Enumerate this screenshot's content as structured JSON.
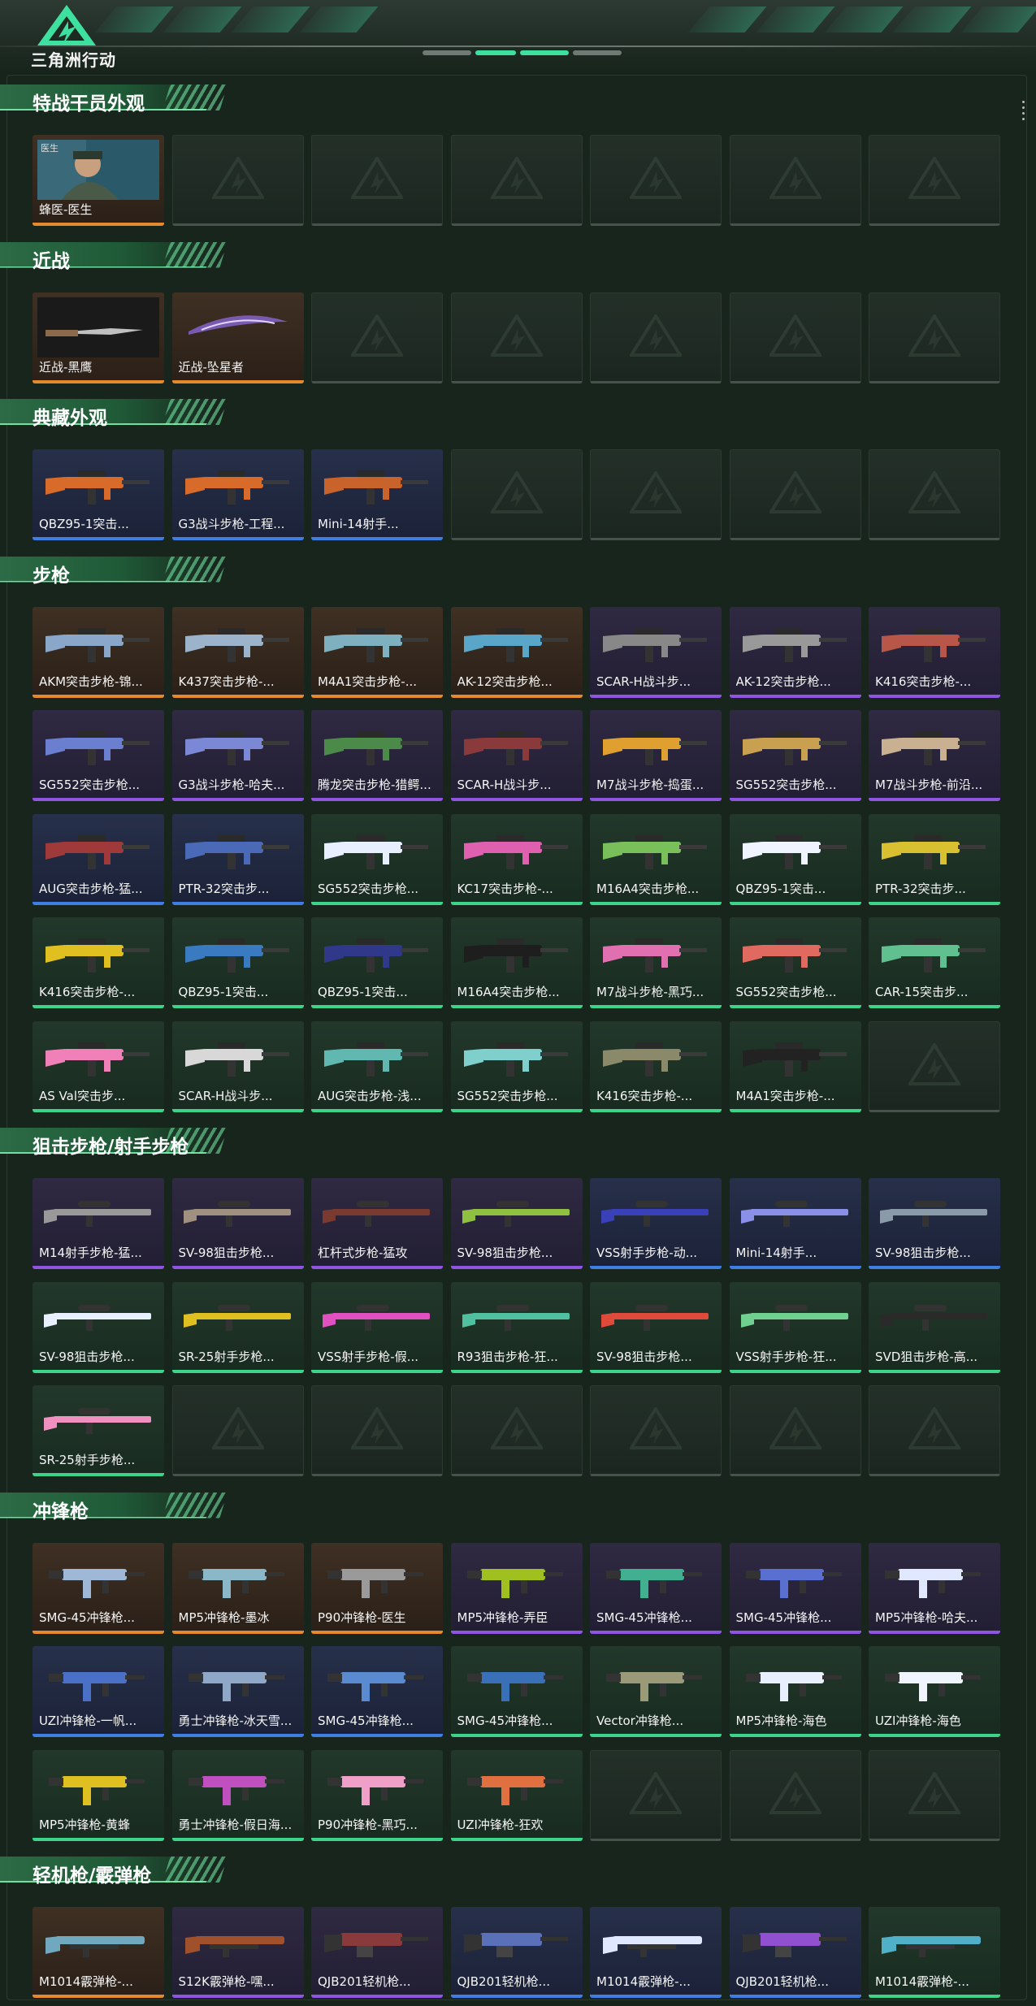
{
  "header": {
    "brand": "三角洲行动",
    "logo_icon": "delta-triangle-logo-icon",
    "accent": "#3ee0a0"
  },
  "rarity_colors": {
    "orange": "#e58a2c",
    "purple": "#8e55e0",
    "blue": "#3f7fe4",
    "green": "#3ed38a",
    "empty": "#46524b"
  },
  "sections": [
    {
      "title": "特战干员外观",
      "items": [
        {
          "label": "蜂医-医生",
          "rarity": "orange",
          "icon": "operator-portrait-icon",
          "badge": "医生"
        },
        {
          "label": "",
          "rarity": "empty"
        },
        {
          "label": "",
          "rarity": "empty"
        },
        {
          "label": "",
          "rarity": "empty"
        },
        {
          "label": "",
          "rarity": "empty"
        },
        {
          "label": "",
          "rarity": "empty"
        },
        {
          "label": "",
          "rarity": "empty"
        }
      ]
    },
    {
      "title": "近战",
      "items": [
        {
          "label": "近战-黑鹰",
          "rarity": "orange",
          "icon": "knife-icon"
        },
        {
          "label": "近战-坠星者",
          "rarity": "orange",
          "icon": "blade-icon"
        },
        {
          "label": "",
          "rarity": "empty"
        },
        {
          "label": "",
          "rarity": "empty"
        },
        {
          "label": "",
          "rarity": "empty"
        },
        {
          "label": "",
          "rarity": "empty"
        },
        {
          "label": "",
          "rarity": "empty"
        }
      ]
    },
    {
      "title": "典藏外观",
      "items": [
        {
          "label": "QBZ95-1突击...",
          "rarity": "blue",
          "icon": "rifle-icon",
          "color": "#d86a2a"
        },
        {
          "label": "G3战斗步枪-工程...",
          "rarity": "blue",
          "icon": "rifle-icon",
          "color": "#d86a2a"
        },
        {
          "label": "Mini-14射手...",
          "rarity": "blue",
          "icon": "rifle-icon",
          "color": "#c9632c"
        },
        {
          "label": "",
          "rarity": "empty"
        },
        {
          "label": "",
          "rarity": "empty"
        },
        {
          "label": "",
          "rarity": "empty"
        },
        {
          "label": "",
          "rarity": "empty"
        }
      ]
    },
    {
      "title": "步枪",
      "items": [
        {
          "label": "AKM突击步枪-锦...",
          "rarity": "orange",
          "icon": "rifle-icon",
          "color": "#8aa6c8"
        },
        {
          "label": "K437突击步枪-...",
          "rarity": "orange",
          "icon": "rifle-icon",
          "color": "#9cb3cc"
        },
        {
          "label": "M4A1突击步枪-...",
          "rarity": "orange",
          "icon": "rifle-icon",
          "color": "#7fb0c0"
        },
        {
          "label": "AK-12突击步枪...",
          "rarity": "orange",
          "icon": "rifle-icon",
          "color": "#5aa6c8"
        },
        {
          "label": "SCAR-H战斗步...",
          "rarity": "purple",
          "icon": "rifle-icon",
          "color": "#888888"
        },
        {
          "label": "AK-12突击步枪...",
          "rarity": "purple",
          "icon": "rifle-icon",
          "color": "#999999"
        },
        {
          "label": "K416突击步枪-...",
          "rarity": "purple",
          "icon": "rifle-icon",
          "color": "#b8564a"
        },
        {
          "label": "SG552突击步枪...",
          "rarity": "purple",
          "icon": "rifle-icon",
          "color": "#6a7fd0"
        },
        {
          "label": "G3战斗步枪-哈夫...",
          "rarity": "purple",
          "icon": "rifle-icon",
          "color": "#7a88d6"
        },
        {
          "label": "腾龙突击步枪-猎鳄...",
          "rarity": "purple",
          "icon": "rifle-icon",
          "color": "#4c8a4a"
        },
        {
          "label": "SCAR-H战斗步...",
          "rarity": "purple",
          "icon": "rifle-icon",
          "color": "#8a3a3a"
        },
        {
          "label": "M7战斗步枪-捣蛋...",
          "rarity": "purple",
          "icon": "rifle-icon",
          "color": "#e0a030"
        },
        {
          "label": "SG552突击步枪...",
          "rarity": "purple",
          "icon": "rifle-icon",
          "color": "#c8a050"
        },
        {
          "label": "M7战斗步枪-前沿...",
          "rarity": "purple",
          "icon": "rifle-icon",
          "color": "#c8b090"
        },
        {
          "label": "AUG突击步枪-猛...",
          "rarity": "blue",
          "icon": "rifle-icon",
          "color": "#a03a3a"
        },
        {
          "label": "PTR-32突击步...",
          "rarity": "blue",
          "icon": "rifle-icon",
          "color": "#4a6ab8"
        },
        {
          "label": "SG552突击步枪...",
          "rarity": "green",
          "icon": "rifle-icon",
          "color": "#e8f0ff"
        },
        {
          "label": "KC17突击步枪-...",
          "rarity": "green",
          "icon": "rifle-icon",
          "color": "#e060b0"
        },
        {
          "label": "M16A4突击步枪...",
          "rarity": "green",
          "icon": "rifle-icon",
          "color": "#7ac05a"
        },
        {
          "label": "QBZ95-1突击...",
          "rarity": "green",
          "icon": "rifle-icon",
          "color": "#f0f4ff"
        },
        {
          "label": "PTR-32突击步...",
          "rarity": "green",
          "icon": "rifle-icon",
          "color": "#d8c030"
        },
        {
          "label": "K416突击步枪-...",
          "rarity": "green",
          "icon": "rifle-icon",
          "color": "#e0c020"
        },
        {
          "label": "QBZ95-1突击...",
          "rarity": "green",
          "icon": "rifle-icon",
          "color": "#3a7ac0"
        },
        {
          "label": "QBZ95-1突击...",
          "rarity": "green",
          "icon": "rifle-icon",
          "color": "#30388a"
        },
        {
          "label": "M16A4突击步枪...",
          "rarity": "green",
          "icon": "rifle-icon",
          "color": "#1e1e1e"
        },
        {
          "label": "M7战斗步枪-黑巧...",
          "rarity": "green",
          "icon": "rifle-icon",
          "color": "#e070b0"
        },
        {
          "label": "SG552突击步枪...",
          "rarity": "green",
          "icon": "rifle-icon",
          "color": "#e06a60"
        },
        {
          "label": "CAR-15突击步...",
          "rarity": "green",
          "icon": "rifle-icon",
          "color": "#60c090"
        },
        {
          "label": "AS Val突击步...",
          "rarity": "green",
          "icon": "rifle-icon",
          "color": "#f080b8"
        },
        {
          "label": "SCAR-H战斗步...",
          "rarity": "green",
          "icon": "rifle-icon",
          "color": "#d8d8d8"
        },
        {
          "label": "AUG突击步枪-浅...",
          "rarity": "green",
          "icon": "rifle-icon",
          "color": "#60b8b0"
        },
        {
          "label": "SG552突击步枪...",
          "rarity": "green",
          "icon": "rifle-icon",
          "color": "#7fd0cc"
        },
        {
          "label": "K416突击步枪-...",
          "rarity": "green",
          "icon": "rifle-icon",
          "color": "#8a8a6a"
        },
        {
          "label": "M4A1突击步枪-...",
          "rarity": "green",
          "icon": "rifle-icon",
          "color": "#222222"
        },
        {
          "label": "",
          "rarity": "empty"
        }
      ]
    },
    {
      "title": "狙击步枪/射手步枪",
      "items": [
        {
          "label": "M14射手步枪-猛...",
          "rarity": "purple",
          "icon": "sniper-icon",
          "color": "#999999"
        },
        {
          "label": "SV-98狙击步枪...",
          "rarity": "purple",
          "icon": "sniper-icon",
          "color": "#a09080"
        },
        {
          "label": "杠杆式步枪-猛攻",
          "rarity": "purple",
          "icon": "sniper-icon",
          "color": "#7a3a30"
        },
        {
          "label": "SV-98狙击步枪...",
          "rarity": "purple",
          "icon": "sniper-icon",
          "color": "#90c040"
        },
        {
          "label": "VSS射手步枪-动...",
          "rarity": "blue",
          "icon": "sniper-icon",
          "color": "#3a40b8"
        },
        {
          "label": "Mini-14射手...",
          "rarity": "blue",
          "icon": "sniper-icon",
          "color": "#8a90e8"
        },
        {
          "label": "SV-98狙击步枪...",
          "rarity": "blue",
          "icon": "sniper-icon",
          "color": "#8a9aa8"
        },
        {
          "label": "SV-98狙击步枪...",
          "rarity": "green",
          "icon": "sniper-icon",
          "color": "#e8f0ff"
        },
        {
          "label": "SR-25射手步枪...",
          "rarity": "green",
          "icon": "sniper-icon",
          "color": "#e0c020"
        },
        {
          "label": "VSS射手步枪-假...",
          "rarity": "green",
          "icon": "sniper-icon",
          "color": "#e050c0"
        },
        {
          "label": "R93狙击步枪-狂...",
          "rarity": "green",
          "icon": "sniper-icon",
          "color": "#50c0a0"
        },
        {
          "label": "SV-98狙击步枪...",
          "rarity": "green",
          "icon": "sniper-icon",
          "color": "#e04a3a"
        },
        {
          "label": "VSS射手步枪-狂...",
          "rarity": "green",
          "icon": "sniper-icon",
          "color": "#70d090"
        },
        {
          "label": "SVD狙击步枪-高...",
          "rarity": "green",
          "icon": "sniper-icon",
          "color": "#2a2a2a"
        },
        {
          "label": "SR-25射手步枪...",
          "rarity": "green",
          "icon": "sniper-icon",
          "color": "#f090c0"
        },
        {
          "label": "",
          "rarity": "empty"
        },
        {
          "label": "",
          "rarity": "empty"
        },
        {
          "label": "",
          "rarity": "empty"
        },
        {
          "label": "",
          "rarity": "empty"
        },
        {
          "label": "",
          "rarity": "empty"
        },
        {
          "label": "",
          "rarity": "empty"
        }
      ]
    },
    {
      "title": "冲锋枪",
      "items": [
        {
          "label": "SMG-45冲锋枪...",
          "rarity": "orange",
          "icon": "smg-icon",
          "color": "#a0b8d8"
        },
        {
          "label": "MP5冲锋枪-墨冰",
          "rarity": "orange",
          "icon": "smg-icon",
          "color": "#8ab8c8"
        },
        {
          "label": "P90冲锋枪-医生",
          "rarity": "orange",
          "icon": "smg-icon",
          "color": "#9a9a9a"
        },
        {
          "label": "MP5冲锋枪-弄臣",
          "rarity": "purple",
          "icon": "smg-icon",
          "color": "#a0c020"
        },
        {
          "label": "SMG-45冲锋枪...",
          "rarity": "purple",
          "icon": "smg-icon",
          "color": "#40b090"
        },
        {
          "label": "SMG-45冲锋枪...",
          "rarity": "purple",
          "icon": "smg-icon",
          "color": "#5a70d0"
        },
        {
          "label": "MP5冲锋枪-哈夫...",
          "rarity": "purple",
          "icon": "smg-icon",
          "color": "#e0e8ff"
        },
        {
          "label": "UZI冲锋枪-一帆...",
          "rarity": "blue",
          "icon": "smg-icon",
          "color": "#4a70c8"
        },
        {
          "label": "勇士冲锋枪-冰天雪...",
          "rarity": "blue",
          "icon": "smg-icon",
          "color": "#90a8c8"
        },
        {
          "label": "SMG-45冲锋枪...",
          "rarity": "blue",
          "icon": "smg-icon",
          "color": "#5a8ad0"
        },
        {
          "label": "SMG-45冲锋枪...",
          "rarity": "green",
          "icon": "smg-icon",
          "color": "#3a70b8"
        },
        {
          "label": "Vector冲锋枪...",
          "rarity": "green",
          "icon": "smg-icon",
          "color": "#9a9a78"
        },
        {
          "label": "MP5冲锋枪-海色",
          "rarity": "green",
          "icon": "smg-icon",
          "color": "#e8f0ff"
        },
        {
          "label": "UZI冲锋枪-海色",
          "rarity": "green",
          "icon": "smg-icon",
          "color": "#f0f4ff"
        },
        {
          "label": "MP5冲锋枪-黄蜂",
          "rarity": "green",
          "icon": "smg-icon",
          "color": "#e0c020"
        },
        {
          "label": "勇士冲锋枪-假日海...",
          "rarity": "green",
          "icon": "smg-icon",
          "color": "#c050c0"
        },
        {
          "label": "P90冲锋枪-黑巧...",
          "rarity": "green",
          "icon": "smg-icon",
          "color": "#f0a0c8"
        },
        {
          "label": "UZI冲锋枪-狂欢",
          "rarity": "green",
          "icon": "smg-icon",
          "color": "#e07040"
        },
        {
          "label": "",
          "rarity": "empty"
        },
        {
          "label": "",
          "rarity": "empty"
        },
        {
          "label": "",
          "rarity": "empty"
        }
      ]
    },
    {
      "title": "轻机枪/霰弹枪",
      "items": [
        {
          "label": "M1014霰弹枪-...",
          "rarity": "orange",
          "icon": "shotgun-icon",
          "color": "#70a8c0"
        },
        {
          "label": "S12K霰弹枪-嘿...",
          "rarity": "purple",
          "icon": "shotgun-icon",
          "color": "#a0502a"
        },
        {
          "label": "QJB201轻机枪...",
          "rarity": "purple",
          "icon": "lmg-icon",
          "color": "#8a3a3a"
        },
        {
          "label": "QJB201轻机枪...",
          "rarity": "blue",
          "icon": "lmg-icon",
          "color": "#5a70b8"
        },
        {
          "label": "M1014霰弹枪-...",
          "rarity": "blue",
          "icon": "shotgun-icon",
          "color": "#e0e8ff"
        },
        {
          "label": "QJB201轻机枪...",
          "rarity": "blue",
          "icon": "lmg-icon",
          "color": "#9050d0"
        },
        {
          "label": "M1014霰弹枪-...",
          "rarity": "green",
          "icon": "shotgun-icon",
          "color": "#50b0c8"
        }
      ]
    }
  ]
}
